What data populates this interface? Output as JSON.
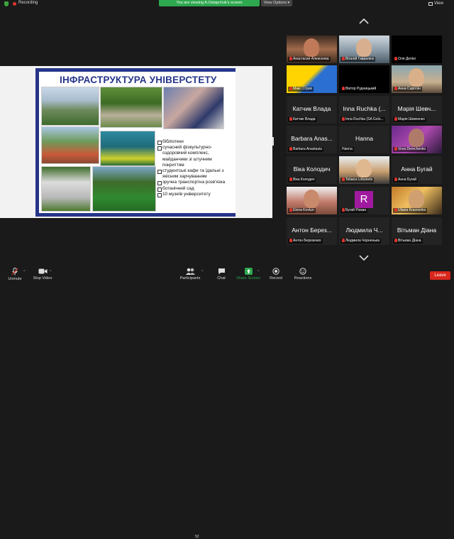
{
  "topbar": {
    "recording_label": "Recording",
    "viewing_banner": "You are viewing A.Ostapchuk's screen",
    "view_options_label": "View Options ▾",
    "view_label": "View"
  },
  "slide": {
    "title": "ІНФРАСТРУКТУРА УНІВЕРСТЕТУ",
    "bullets": [
      "бібліотеки",
      "сучасний фізкультурно-оздоровчий комплекс, майданчики зі штучним покриттям",
      "студентські кафе та їдальні з якісним харчуванням",
      "зручна транспортна розв'язка",
      "ботанічний сад",
      "10 музеїв університету"
    ]
  },
  "gallery": {
    "tiles": [
      {
        "label": "Анастасия Алексеева",
        "display": ""
      },
      {
        "label": "Віталій Гаврилюк",
        "display": ""
      },
      {
        "label": "Оля Делінi",
        "display": ""
      },
      {
        "label": "Макс Стрих",
        "display": ""
      },
      {
        "label": "Віктор Рудницький",
        "display": ""
      },
      {
        "label": "Анна Саргсян",
        "display": ""
      },
      {
        "label": "Катчик Влада",
        "display": "Катчик Влада"
      },
      {
        "label": "Inna Ruchka (SA Golo...",
        "display": "Inna Ruchka (..."
      },
      {
        "label": "Марія Шевченко",
        "display": "Марія Шевч..."
      },
      {
        "label": "Barbara Anastasia",
        "display": "Barbara Anas..."
      },
      {
        "label": "Hanna",
        "display": "Hanna"
      },
      {
        "label": "Vova Demchenko",
        "display": ""
      },
      {
        "label": "Віка Колодич",
        "display": "Віка Колодич"
      },
      {
        "label": "Tetiana Lobunets",
        "display": ""
      },
      {
        "label": "Анна Бугай",
        "display": "Анна Бугай"
      },
      {
        "label": "Elena Kovtun",
        "display": ""
      },
      {
        "label": "Бугай Роман",
        "display": "R"
      },
      {
        "label": "Uliana Krasnenko",
        "display": ""
      },
      {
        "label": "Антон Березенко",
        "display": "Антон Берез..."
      },
      {
        "label": "Людмила Чорненька",
        "display": "Людмила Ч..."
      },
      {
        "label": "Вітьман Діана",
        "display": "Вітьман Діана"
      }
    ]
  },
  "toolbar": {
    "unmute": "Unmute",
    "stop_video": "Stop Video",
    "participants": "Participants",
    "participants_count": "52",
    "chat": "Chat",
    "share_screen": "Share Screen",
    "record": "Record",
    "reactions": "Reactions",
    "leave": "Leave"
  },
  "colors": {
    "share_green": "#2ea84f",
    "leave_red": "#d9261c",
    "slide_blue": "#26358a",
    "muted_red": "#e0342c"
  }
}
